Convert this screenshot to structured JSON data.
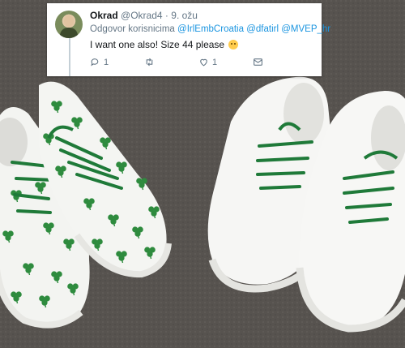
{
  "tweet": {
    "author_name": "Okrad",
    "author_handle": "@Okrad4",
    "separator": "·",
    "date": "9. ožu",
    "reply_prefix": "Odgovor korisnicima",
    "mentions": [
      "@IrlEmbCroatia",
      "@dfatirl",
      "@MVEP_hr"
    ],
    "text": "I want one also! Size 44 please",
    "emoji_icon": "grinning-sweat-emoji",
    "reply_count": "1",
    "retweet_count": "",
    "like_count": "1"
  },
  "colors": {
    "link": "#1b95e0",
    "muted": "#657786",
    "shamrock": "#2e8b3e",
    "laces": "#1f7a39"
  }
}
